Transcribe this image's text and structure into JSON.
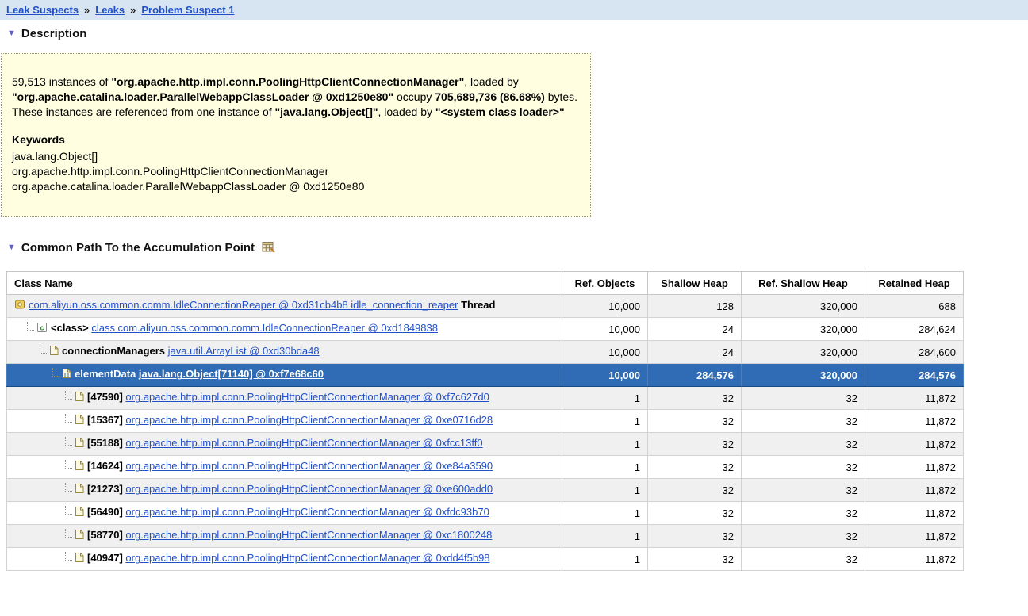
{
  "colors": {
    "link": "#2050c8",
    "breadcrumb_bg": "#d7e4f2",
    "description_box_bg": "#fffee1",
    "row_stripe": "#f0f0f0",
    "selected_row_bg": "#2f6cb5",
    "selected_row_text": "#ffffff",
    "section_arrow": "#6060c0"
  },
  "breadcrumb": {
    "separator": "»",
    "items": [
      {
        "label": "Leak Suspects"
      },
      {
        "label": "Leaks"
      },
      {
        "label": "Problem Suspect 1"
      }
    ]
  },
  "sections": {
    "description": {
      "title": "Description"
    },
    "path": {
      "title": "Common Path To the Accumulation Point"
    }
  },
  "description": {
    "segments": [
      {
        "text": "59,513 instances of ",
        "bold": false
      },
      {
        "text": "\"org.apache.http.impl.conn.PoolingHttpClientConnectionManager\"",
        "bold": true
      },
      {
        "text": ", loaded by ",
        "bold": false
      },
      {
        "text": "\"org.apache.catalina.loader.ParallelWebappClassLoader @ 0xd1250e80\"",
        "bold": true
      },
      {
        "text": " occupy ",
        "bold": false
      },
      {
        "text": "705,689,736 (86.68%)",
        "bold": true
      },
      {
        "text": " bytes. These instances are referenced from one instance of ",
        "bold": false
      },
      {
        "text": "\"java.lang.Object[]\"",
        "bold": true
      },
      {
        "text": ", loaded by ",
        "bold": false
      },
      {
        "text": "\"<system class loader>\"",
        "bold": true
      }
    ],
    "keywords_title": "Keywords",
    "keywords": [
      "java.lang.Object[]",
      "org.apache.http.impl.conn.PoolingHttpClientConnectionManager",
      "org.apache.catalina.loader.ParallelWebappClassLoader @ 0xd1250e80"
    ]
  },
  "table": {
    "headers": [
      "Class Name",
      "Ref. Objects",
      "Shallow Heap",
      "Ref. Shallow Heap",
      "Retained Heap"
    ],
    "rows": [
      {
        "indent": 0,
        "icon": "thread-icon",
        "prefix": "",
        "link": "com.aliyun.oss.common.comm.IdleConnectionReaper @ 0xd31cb4b8 idle_connection_reaper",
        "suffix": "Thread",
        "cells": [
          "10,000",
          "128",
          "320,000",
          "688"
        ],
        "selected": false
      },
      {
        "indent": 1,
        "icon": "class-icon",
        "prefix": "<class>",
        "link": "class com.aliyun.oss.common.comm.IdleConnectionReaper @ 0xd1849838",
        "suffix": "",
        "cells": [
          "10,000",
          "24",
          "320,000",
          "284,624"
        ],
        "selected": false
      },
      {
        "indent": 2,
        "icon": "object-icon",
        "prefix": "connectionManagers",
        "link": "java.util.ArrayList @ 0xd30bda48",
        "suffix": "",
        "cells": [
          "10,000",
          "24",
          "320,000",
          "284,600"
        ],
        "selected": false
      },
      {
        "indent": 3,
        "icon": "array-icon",
        "prefix": "elementData",
        "link": "java.lang.Object[71140] @ 0xf7e68c60",
        "suffix": "",
        "cells": [
          "10,000",
          "284,576",
          "320,000",
          "284,576"
        ],
        "selected": true
      },
      {
        "indent": 4,
        "icon": "object-icon",
        "prefix": "[47590]",
        "link": "org.apache.http.impl.conn.PoolingHttpClientConnectionManager @ 0xf7c627d0",
        "suffix": "",
        "cells": [
          "1",
          "32",
          "32",
          "11,872"
        ],
        "selected": false
      },
      {
        "indent": 4,
        "icon": "object-icon",
        "prefix": "[15367]",
        "link": "org.apache.http.impl.conn.PoolingHttpClientConnectionManager @ 0xe0716d28",
        "suffix": "",
        "cells": [
          "1",
          "32",
          "32",
          "11,872"
        ],
        "selected": false
      },
      {
        "indent": 4,
        "icon": "object-icon",
        "prefix": "[55188]",
        "link": "org.apache.http.impl.conn.PoolingHttpClientConnectionManager @ 0xfcc13ff0",
        "suffix": "",
        "cells": [
          "1",
          "32",
          "32",
          "11,872"
        ],
        "selected": false
      },
      {
        "indent": 4,
        "icon": "object-icon",
        "prefix": "[14624]",
        "link": "org.apache.http.impl.conn.PoolingHttpClientConnectionManager @ 0xe84a3590",
        "suffix": "",
        "cells": [
          "1",
          "32",
          "32",
          "11,872"
        ],
        "selected": false
      },
      {
        "indent": 4,
        "icon": "object-icon",
        "prefix": "[21273]",
        "link": "org.apache.http.impl.conn.PoolingHttpClientConnectionManager @ 0xe600add0",
        "suffix": "",
        "cells": [
          "1",
          "32",
          "32",
          "11,872"
        ],
        "selected": false
      },
      {
        "indent": 4,
        "icon": "object-icon",
        "prefix": "[56490]",
        "link": "org.apache.http.impl.conn.PoolingHttpClientConnectionManager @ 0xfdc93b70",
        "suffix": "",
        "cells": [
          "1",
          "32",
          "32",
          "11,872"
        ],
        "selected": false
      },
      {
        "indent": 4,
        "icon": "object-icon",
        "prefix": "[58770]",
        "link": "org.apache.http.impl.conn.PoolingHttpClientConnectionManager @ 0xc1800248",
        "suffix": "",
        "cells": [
          "1",
          "32",
          "32",
          "11,872"
        ],
        "selected": false
      },
      {
        "indent": 4,
        "icon": "object-icon",
        "prefix": "[40947]",
        "link": "org.apache.http.impl.conn.PoolingHttpClientConnectionManager @ 0xdd4f5b98",
        "suffix": "",
        "cells": [
          "1",
          "32",
          "32",
          "11,872"
        ],
        "selected": false
      }
    ]
  }
}
